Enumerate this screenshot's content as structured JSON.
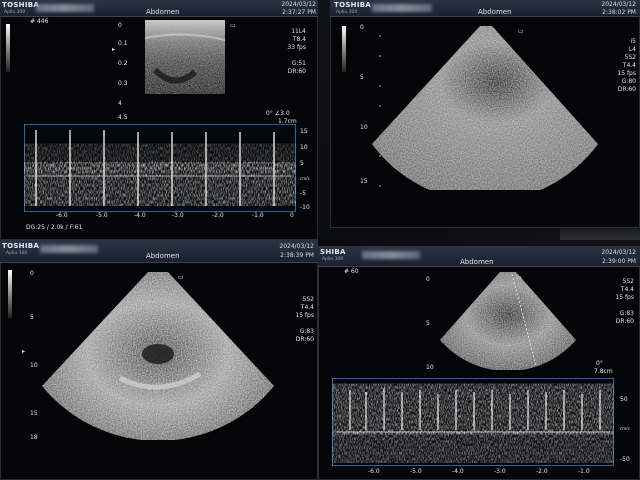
{
  "panels": {
    "tl": {
      "brand": "TOSHIBA",
      "site": "Aplio 300",
      "exam": "Abdomen",
      "date": "2024/03/12",
      "time": "2:37:27 PM",
      "frame": "# 446",
      "settings": [
        "11L4",
        "T8.4",
        "33 fps",
        "",
        "G:51",
        "DR:60"
      ],
      "angle": "0°  ∠3.0",
      "depth": "1.7cm",
      "gate_line": "DG:25 / 2.0k / F:61",
      "depth_ticks": [
        "0",
        "0.1",
        "0.2",
        "0.3",
        "4",
        "4.5"
      ],
      "time_ticks": [
        "-6.0",
        "-5.0",
        "-4.0",
        "-3.0",
        "-2.0",
        "-1.0",
        "0"
      ],
      "vel_ticks": [
        "15",
        "10",
        "5",
        "cm/s",
        "-5",
        "-10"
      ]
    },
    "tr": {
      "brand": "TOSHIBA",
      "site": "Aplio 300",
      "exam": "Abdomen",
      "date": "2024/03/12",
      "time": "2:38:02 PM",
      "settings": [
        "i5",
        "L4",
        "5S2",
        "T4.4",
        "15 fps",
        "G:80",
        "DR:60"
      ],
      "depth_ticks": [
        "0",
        "5",
        "10",
        "15"
      ]
    },
    "bl": {
      "brand": "TOSHIBA",
      "site": "Aplio 300",
      "exam": "Abdomen",
      "date": "2024/03/12",
      "time": "2:38:39 PM",
      "settings": [
        "5S2",
        "T4.4",
        "15 fps",
        "",
        "G:83",
        "DR:60"
      ],
      "depth_ticks": [
        "0",
        "5",
        "10",
        "15",
        "18"
      ]
    },
    "br": {
      "brand": "SHIBA",
      "site": "Aplio 300",
      "exam": "Abdomen",
      "date": "2024/03/12",
      "time": "2:39:00 PM",
      "frame": "# 60",
      "settings": [
        "5S2",
        "T4.4",
        "15 fps",
        "",
        "G:83",
        "DR:60"
      ],
      "angle": "0°",
      "depth": "7.8cm",
      "depth_ticks": [
        "0",
        "5",
        "10"
      ],
      "time_ticks": [
        "-6.0",
        "-5.0",
        "-4.0",
        "-3.0",
        "-2.0",
        "-1.0"
      ],
      "vel_ticks": [
        "50",
        "cm/s",
        "-50"
      ]
    }
  }
}
